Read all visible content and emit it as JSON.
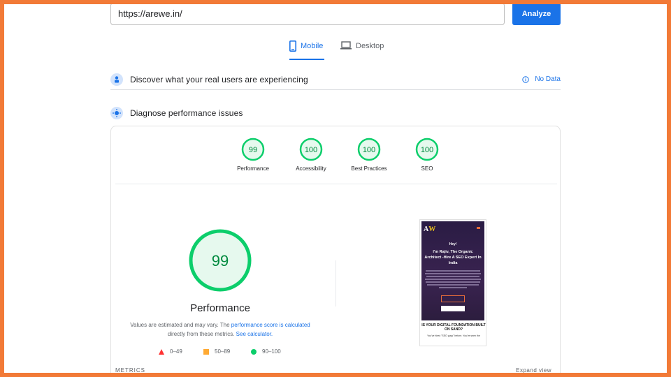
{
  "search": {
    "url": "https://arewe.in/",
    "analyze_label": "Analyze"
  },
  "tabs": [
    {
      "label": "Mobile",
      "icon": "smartphone-icon",
      "selected": true
    },
    {
      "label": "Desktop",
      "icon": "laptop-icon",
      "selected": false
    }
  ],
  "field_data": {
    "title": "Discover what your real users are experiencing",
    "status": "No Data"
  },
  "diagnose": {
    "title": "Diagnose performance issues"
  },
  "scores": [
    {
      "label": "Performance",
      "value": "99"
    },
    {
      "label": "Accessibility",
      "value": "100"
    },
    {
      "label": "Best Practices",
      "value": "100"
    },
    {
      "label": "SEO",
      "value": "100"
    }
  ],
  "performance": {
    "score": "99",
    "title": "Performance",
    "note_pre": "Values are estimated and may vary. The ",
    "note_link1": "performance score is calculated",
    "note_mid": " directly from these metrics. ",
    "note_link2": "See calculator."
  },
  "legend": [
    {
      "range": "0–49",
      "shape": "triangle",
      "color": "#ff3333"
    },
    {
      "range": "50–89",
      "shape": "square",
      "color": "#ffaa33"
    },
    {
      "range": "90–100",
      "shape": "circle",
      "color": "#0cce6b"
    }
  ],
  "metrics": {
    "label": "METRICS",
    "expand": "Expand view"
  },
  "thumbnail": {
    "logo_a": "A",
    "logo_w": "W",
    "greeting": "Hey!",
    "headline": "I'm Rajiv, The Organic Architect -Hire A SEO Expert In India",
    "question": "IS YOUR DIGITAL FOUNDATION BUILT ON SAND?",
    "subtext": "You've hired \"SEO guys\" before. You've seen the"
  },
  "colors": {
    "accent": "#1a73e8",
    "good": "#0cce6b",
    "frame": "#f27a37"
  }
}
